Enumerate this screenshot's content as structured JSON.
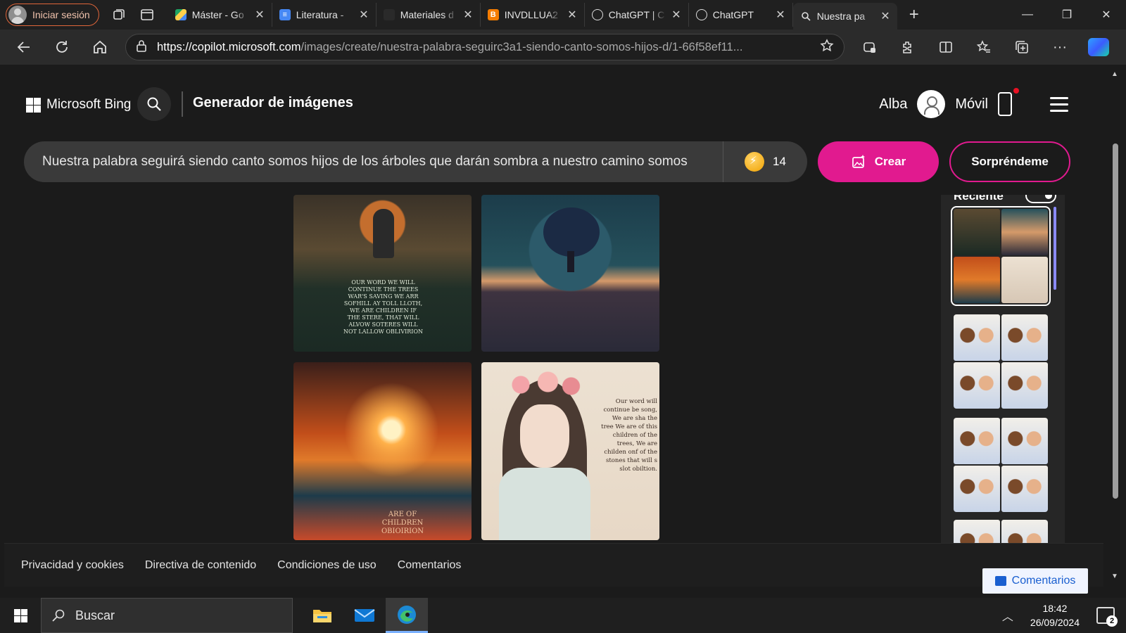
{
  "browser": {
    "profile_label": "Iniciar sesión",
    "tabs": [
      {
        "label": "Máster - Go",
        "favicon": "drive-icon",
        "active": false
      },
      {
        "label": "Literatura -",
        "favicon": "docs-icon",
        "active": false
      },
      {
        "label": "Materiales d",
        "favicon": "blank-icon",
        "active": false
      },
      {
        "label": "INVDLLUA2",
        "favicon": "blogger-icon",
        "active": false
      },
      {
        "label": "ChatGPT | C",
        "favicon": "openai-icon",
        "active": false
      },
      {
        "label": "ChatGPT",
        "favicon": "openai-icon",
        "active": false
      },
      {
        "label": "Nuestra pa",
        "favicon": "search-icon",
        "active": true
      }
    ],
    "url_host": "https://copilot.microsoft.com",
    "url_path": "/images/create/nuestra-palabra-seguirc3a1-siendo-canto-somos-hijos-d/1-66f58ef11..."
  },
  "header": {
    "brand": "Microsoft Bing",
    "title": "Generador de imágenes",
    "user_name": "Alba",
    "mobile_label": "Móvil"
  },
  "prompt": {
    "value": "Nuestra palabra seguirá siendo canto somos hijos de los árboles que darán sombra a nuestro camino somos",
    "boosts": "14",
    "create_label": "Crear",
    "surprise_label": "Sorpréndeme"
  },
  "results": {
    "img1_caption": "OUR WORD WE WILL CONTINUE THE TREES WAR'S SAVING WE ARR SOFHILL AY TOLL LLOTH, WE ARE CHILDREN IF THE STERE, THAT WILL ALVOW SOTERES WILL NOT LALLOW OBLIVIRION",
    "img3_caption": "ARE OF CHILDREN OBIOIRION",
    "img4_caption": "Our word will continue be song, We are sha the tree We are of this children of the trees, We are childen onf of the stones that will s slot obiltion."
  },
  "recent": {
    "title": "Reciente"
  },
  "footer": {
    "links": [
      "Privacidad y cookies",
      "Directiva de contenido",
      "Condiciones de uso",
      "Comentarios"
    ],
    "feedback_button": "Comentarios"
  },
  "taskbar": {
    "search_placeholder": "Buscar",
    "time": "18:42",
    "date": "26/09/2024",
    "notifications": "2"
  }
}
